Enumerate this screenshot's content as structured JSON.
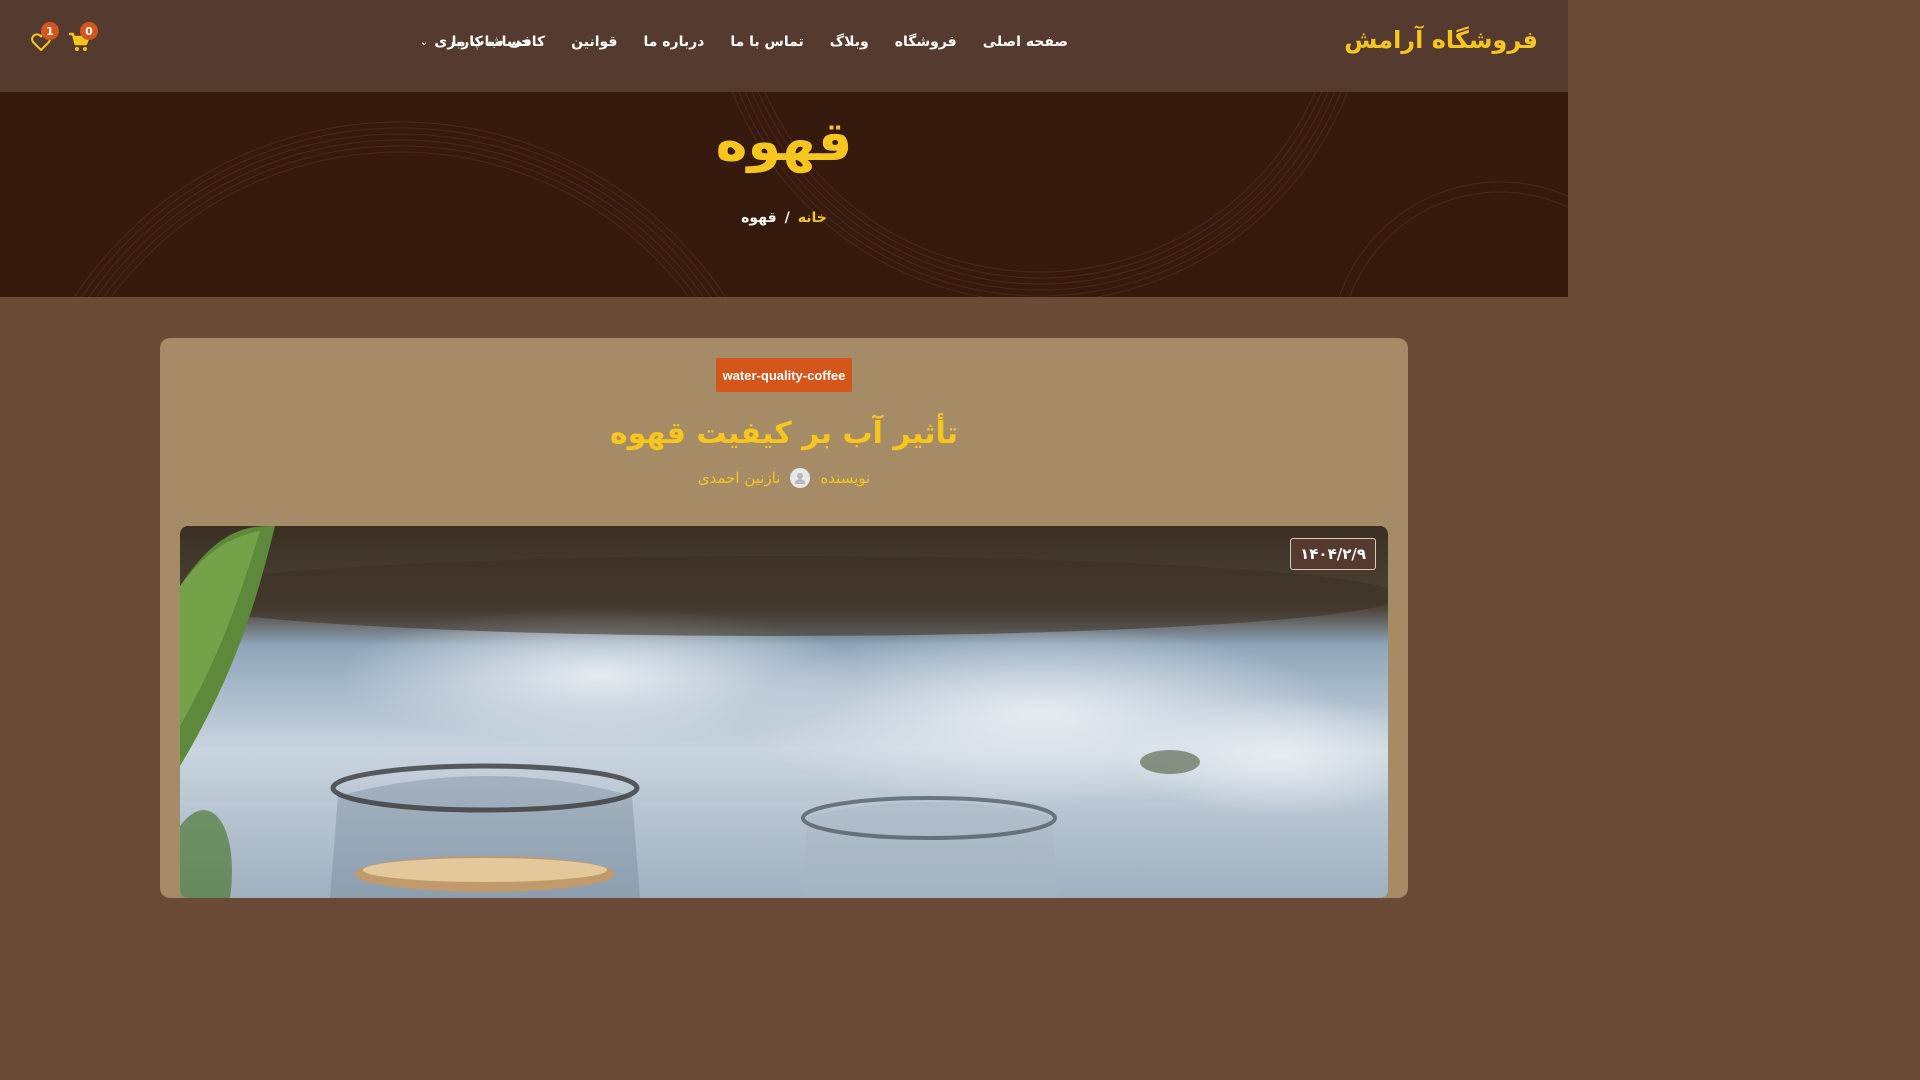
{
  "header": {
    "logo": "فروشگاه آرامش",
    "nav": [
      {
        "label": "صفحه اصلی"
      },
      {
        "label": "فروشگاه"
      },
      {
        "label": "وبلاگ"
      },
      {
        "label": "تماس با ما"
      },
      {
        "label": "درباره ما"
      },
      {
        "label": "قوانین"
      },
      {
        "label": "کافی شاپ ما"
      }
    ],
    "account_label": "حساب کاربری",
    "cart_count": "0",
    "wishlist_count": "1"
  },
  "hero": {
    "title": "قهوه",
    "breadcrumb_home": "خانه",
    "breadcrumb_separator": "/",
    "breadcrumb_current": "قهوه"
  },
  "post": {
    "tag": "water-quality-coffee",
    "title": "تأثیر آب بر کیفیت قهوه",
    "author_label": "نویسنده",
    "author_name": "نازنین احمدی",
    "date": "۱۴۰۴/۲/۹"
  },
  "colors": {
    "header_bg": "#553a30",
    "hero_bg": "#361a0d",
    "page_bg": "#6b4b35",
    "card_bg": "#a58b66",
    "accent_yellow": "#f7c61e",
    "badge_orange": "#d4561b"
  },
  "icons": {
    "cart": "cart-icon",
    "wishlist": "heart-icon",
    "chevron": "chevron-down-icon",
    "avatar": "user-avatar-icon"
  }
}
